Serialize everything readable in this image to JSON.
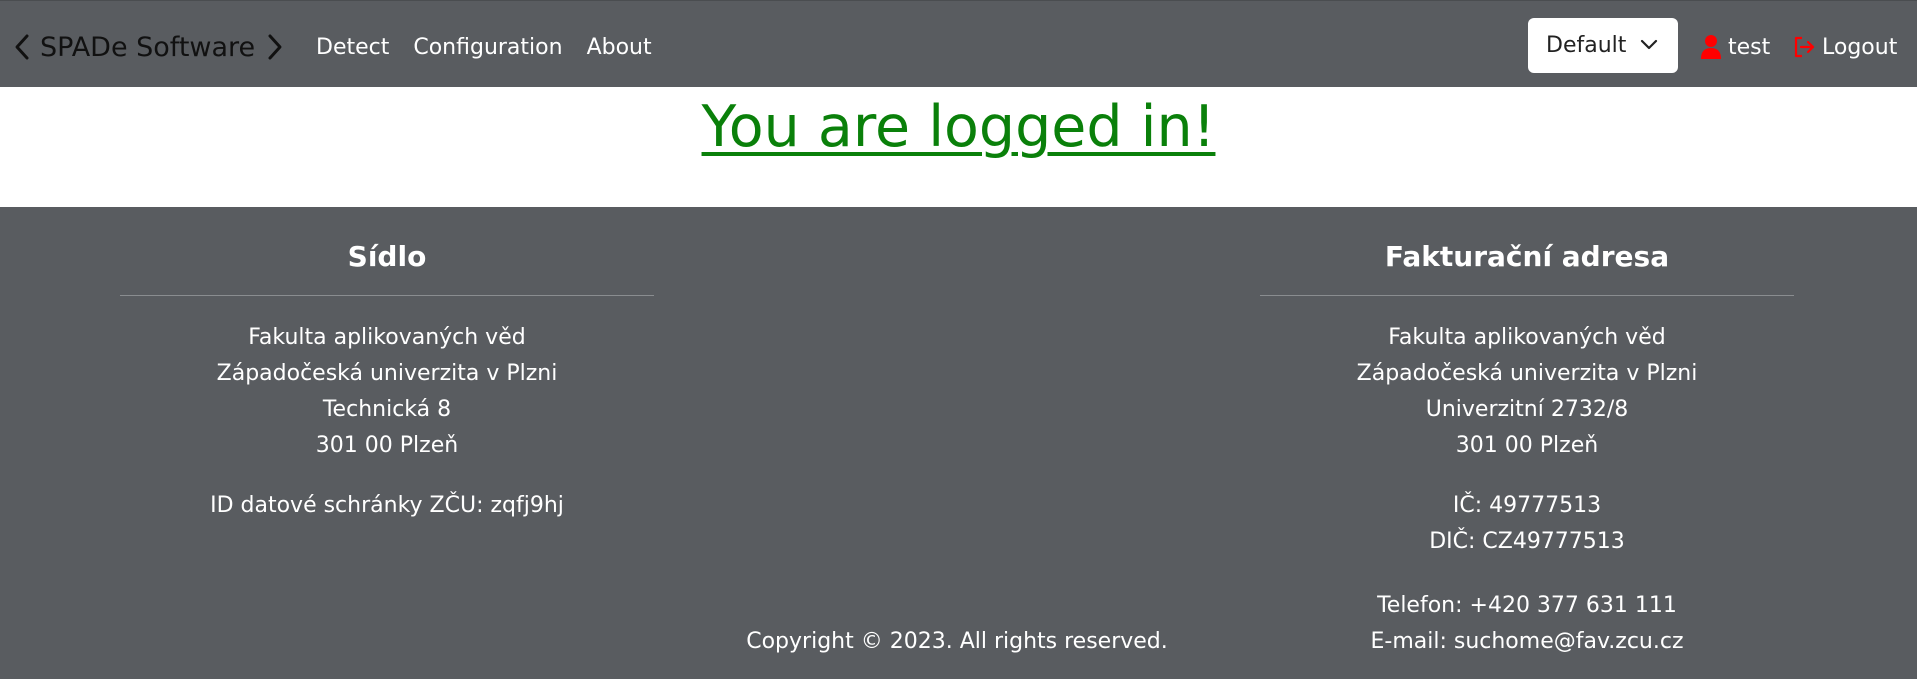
{
  "navbar": {
    "brand": "SPADe Software",
    "links": [
      "Detect",
      "Configuration",
      "About"
    ],
    "dropdown_value": "Default",
    "user_name": "test",
    "logout_label": "Logout",
    "icon_color": "#ff0000"
  },
  "main": {
    "message": "You are logged in!",
    "message_color": "#0a800a"
  },
  "footer": {
    "left": {
      "title": "Sídlo",
      "address": [
        "Fakulta aplikovaných věd",
        "Západočeská univerzita v Plzni",
        "Technická 8",
        "301 00 Plzeň"
      ],
      "databox": "ID datové schránky ZČU: zqfj9hj"
    },
    "right": {
      "title": "Fakturační adresa",
      "address": [
        "Fakulta aplikovaných věd",
        "Západočeská univerzita v Plzni",
        "Univerzitní 2732/8",
        "301 00 Plzeň"
      ],
      "ids": [
        "IČ: 49777513",
        "DIČ: CZ49777513"
      ],
      "contact": [
        "Telefon: +420 377 631 111",
        "E-mail: suchome@fav.zcu.cz"
      ]
    },
    "copyright": "Copyright © 2023. All rights reserved."
  }
}
